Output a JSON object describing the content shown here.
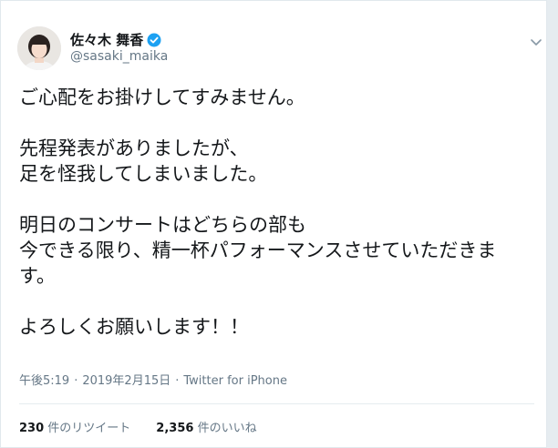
{
  "user": {
    "display_name": "佐々木 舞香",
    "handle": "@sasaki_maika",
    "verified": true,
    "avatar_icon": "profile-photo"
  },
  "tweet": {
    "lines": [
      "ご心配をお掛けしてすみません。",
      "",
      "先程発表がありましたが、",
      "足を怪我してしまいました。",
      "",
      "明日のコンサートはどちらの部も",
      "今できる限り、精一杯パフォーマンスさせていただきま",
      "す。",
      "",
      "よろしくお願いします！！"
    ]
  },
  "meta": {
    "time": "午後5:19",
    "separator": "·",
    "date": "2019年2月15日",
    "source": "Twitter for iPhone"
  },
  "stats": {
    "retweets_count": "230",
    "retweets_label": "件のリツイート",
    "likes_count": "2,356",
    "likes_label": "件のいいね"
  },
  "colors": {
    "verified_blue": "#1da1f2",
    "text_primary": "#14171a",
    "text_secondary": "#657786"
  }
}
